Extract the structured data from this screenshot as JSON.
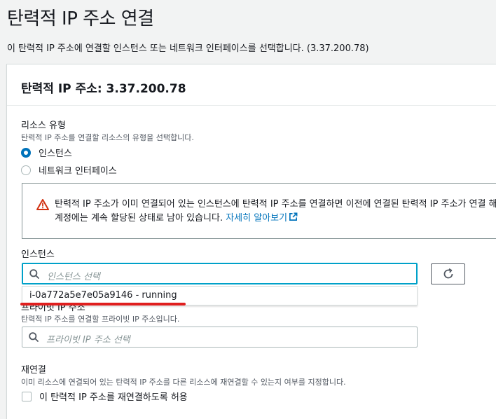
{
  "page": {
    "title": "탄력적 IP 주소 연결",
    "description": "이 탄력적 IP 주소에 연결할 인스턴스 또는 네트워크 인터페이스를 선택합니다. (3.37.200.78)"
  },
  "panel": {
    "title": "탄력적 IP 주소: 3.37.200.78"
  },
  "resource_type": {
    "label": "리소스 유형",
    "description": "탄력적 IP 주소를 연결할 리소스의 유형을 선택합니다.",
    "options": [
      {
        "label": "인스턴스",
        "selected": true
      },
      {
        "label": "네트워크 인터페이스",
        "selected": false
      }
    ]
  },
  "alert": {
    "line1": "탄력적 IP 주소가 이미 연결되어 있는 인스턴스에 탄력적 IP 주소를 연결하면 이전에 연결된 탄력적 IP 주소가 연결 해",
    "line2": "계정에는 계속 할당된 상태로 남아 있습니다. ",
    "link": "자세히 알아보기"
  },
  "instance": {
    "label": "인스턴스",
    "placeholder": "인스턴스 선택",
    "dropdown_option": "i-0a772a5e7e05a9146 - running"
  },
  "private_ip": {
    "label": "프라이빗 IP 주소",
    "description": "탄력적 IP 주소를 연결할 프라이빗 IP 주소입니다.",
    "placeholder": "프라이빗 IP 주소 선택"
  },
  "reassociation": {
    "label": "재연결",
    "description": "이미 리소스에 연결되어 있는 탄력적 IP 주소를 다른 리소스에 재연결할 수 있는지 여부를 지정합니다.",
    "checkbox_label": "이 탄력적 IP 주소를 재연결하도록 허용",
    "checked": false
  },
  "colors": {
    "accent": "#0073bb",
    "focus": "#00a1c9",
    "warning": "#d13212",
    "annotation": "#e01f1f"
  }
}
